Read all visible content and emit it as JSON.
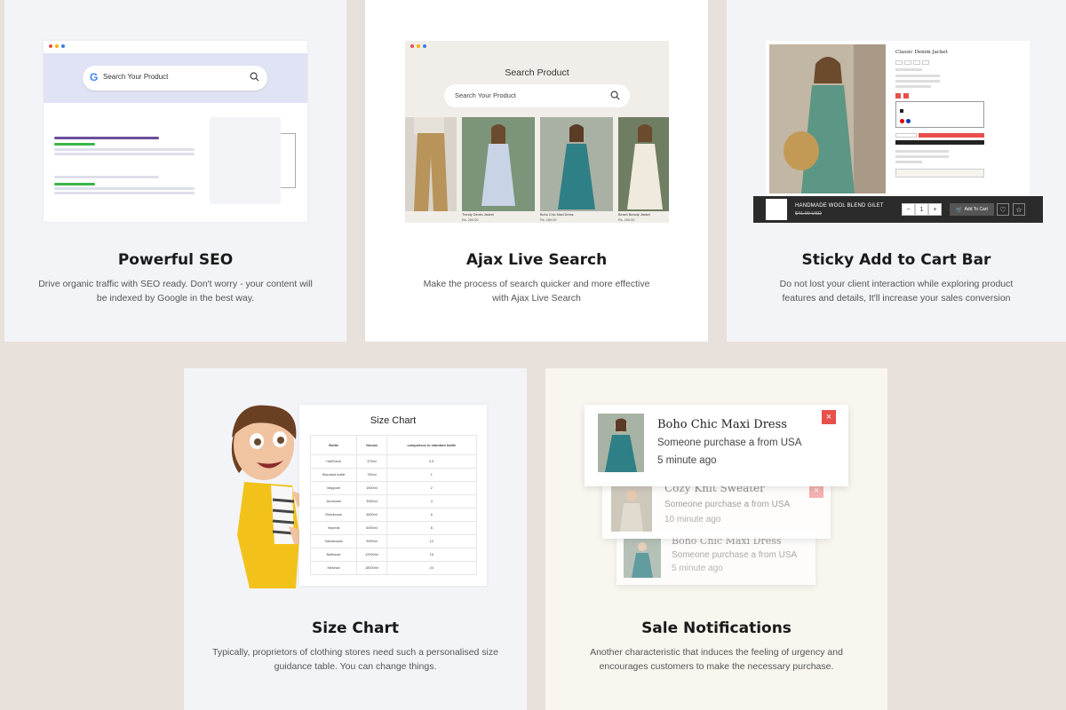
{
  "cards": {
    "seo": {
      "title": "Powerful SEO",
      "desc_line1": "Drive organic traffic with SEO ready.  Don't worry - your content will",
      "desc_line2": "be indexed by Google in the best way.",
      "search_placeholder": "Search Your Product",
      "search_logo": "G"
    },
    "ajax": {
      "title": "Ajax Live Search",
      "desc_line1": "Make the process of search quicker and more effective",
      "desc_line2": "with Ajax Live Search",
      "mock_title": "Search Product",
      "search_placeholder": "Search Your Product",
      "products": [
        {
          "name": "",
          "price": ""
        },
        {
          "name": "Trendy Denim Jacket",
          "price": "Rs. 200.00"
        },
        {
          "name": "Boho Chic Maxi Dress",
          "price": "Rs. 180.00"
        },
        {
          "name": "Beach Beauty Jacket",
          "price": "Rs. 200.00"
        }
      ]
    },
    "sticky": {
      "title": "Sticky Add to Cart Bar",
      "desc_line1": "Do not lost your client interaction while exploring product",
      "desc_line2": "features and details, It'll increase your sales conversion",
      "product_title": "Classic Denim Jacket",
      "bar_name": "HANDMADE WOOL BLEND GILET",
      "bar_price": "$41.00 USD",
      "qty_minus": "−",
      "qty_value": "1",
      "qty_plus": "+",
      "add_to_cart": "Add To Cart",
      "heart_icon": "♡",
      "star_icon": "☆",
      "cart_icon": "🛒"
    },
    "size_chart": {
      "title": "Size Chart",
      "desc_line1": "Typically, proprietors of clothing stores need such a personalised size",
      "desc_line2": "guidance table. You can change things.",
      "table_title": "Size Chart",
      "headers": [
        "Bottle",
        "Volume",
        "comparison to standard bottle"
      ],
      "rows": [
        [
          "Half/Demi",
          "375ml",
          "0.5"
        ],
        [
          "Standard bottle",
          "750ml",
          "1"
        ],
        [
          "Magnum",
          "1500ml",
          "2"
        ],
        [
          "Jeroboam",
          "3000ml",
          "4"
        ],
        [
          "Rehoboam",
          "4500ml",
          "6"
        ],
        [
          "Imperial",
          "6000ml",
          "8"
        ],
        [
          "Salmanazar",
          "9000ml",
          "12"
        ],
        [
          "Balthazar",
          "12000ml",
          "16"
        ],
        [
          "Melchior",
          "18000ml",
          "24"
        ]
      ]
    },
    "sale": {
      "title": "Sale Notifications",
      "desc_line1": "Another characteristic that induces the feeling of urgency and",
      "desc_line2": "encourages customers to make the necessary purchase.",
      "notifications": [
        {
          "name": "Boho Chic Maxi Dress",
          "text": "Someone purchase a  from USA",
          "time": "5 minute ago"
        },
        {
          "name": "Cozy Knit Sweater",
          "text": "Someone purchase a  from USA",
          "time": "10 minute ago"
        },
        {
          "name": "Boho Chic Maxi Dress",
          "text": "Someone purchase a  from USA",
          "time": "5 minute ago"
        }
      ],
      "close_icon": "×"
    }
  },
  "colors": {
    "bg": "#e8e0da",
    "accent_red": "#e8504b",
    "seo_purple": "#6b4e9b",
    "seo_green": "#3bb54a"
  }
}
